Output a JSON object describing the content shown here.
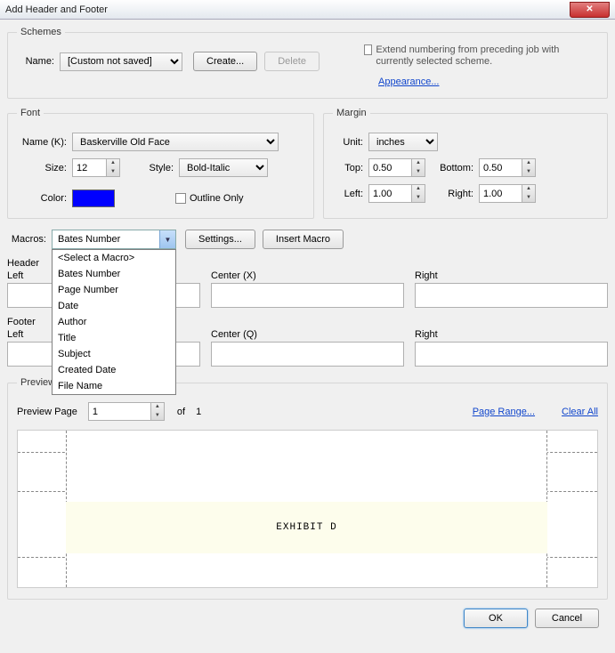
{
  "window": {
    "title": "Add Header and Footer"
  },
  "schemes": {
    "legend": "Schemes",
    "name_label": "Name:",
    "name_value": "[Custom not saved]",
    "create": "Create...",
    "delete": "Delete",
    "extend_label": "Extend numbering from preceding job with currently selected scheme.",
    "appearance": "Appearance..."
  },
  "font": {
    "legend": "Font",
    "name_label": "Name (K):",
    "name_value": "Baskerville Old Face",
    "size_label": "Size:",
    "size_value": "12",
    "style_label": "Style:",
    "style_value": "Bold-Italic",
    "color_label": "Color:",
    "outline_label": "Outline Only"
  },
  "margin": {
    "legend": "Margin",
    "unit_label": "Unit:",
    "unit_value": "inches",
    "top_label": "Top:",
    "top_value": "0.50",
    "bottom_label": "Bottom:",
    "bottom_value": "0.50",
    "left_label": "Left:",
    "left_value": "1.00",
    "right_label": "Right:",
    "right_value": "1.00"
  },
  "macros": {
    "label": "Macros:",
    "selected": "Bates Number",
    "settings": "Settings...",
    "insert": "Insert Macro",
    "options": [
      "<Select a Macro>",
      "Bates Number",
      "Page Number",
      "Date",
      "Author",
      "Title",
      "Subject",
      "Created Date",
      "File Name"
    ]
  },
  "header": {
    "label": "Header",
    "left": "Left",
    "center": "Center (X)",
    "right": "Right"
  },
  "footer": {
    "label": "Footer",
    "left": "Left",
    "center": "Center (Q)",
    "right": "Right"
  },
  "preview": {
    "legend": "Preview",
    "page_label": "Preview Page",
    "page_value": "1",
    "of_label": "of",
    "total": "1",
    "range": "Page Range...",
    "clear": "Clear All",
    "exhibit": "EXHIBIT D"
  },
  "buttons": {
    "ok": "OK",
    "cancel": "Cancel"
  }
}
